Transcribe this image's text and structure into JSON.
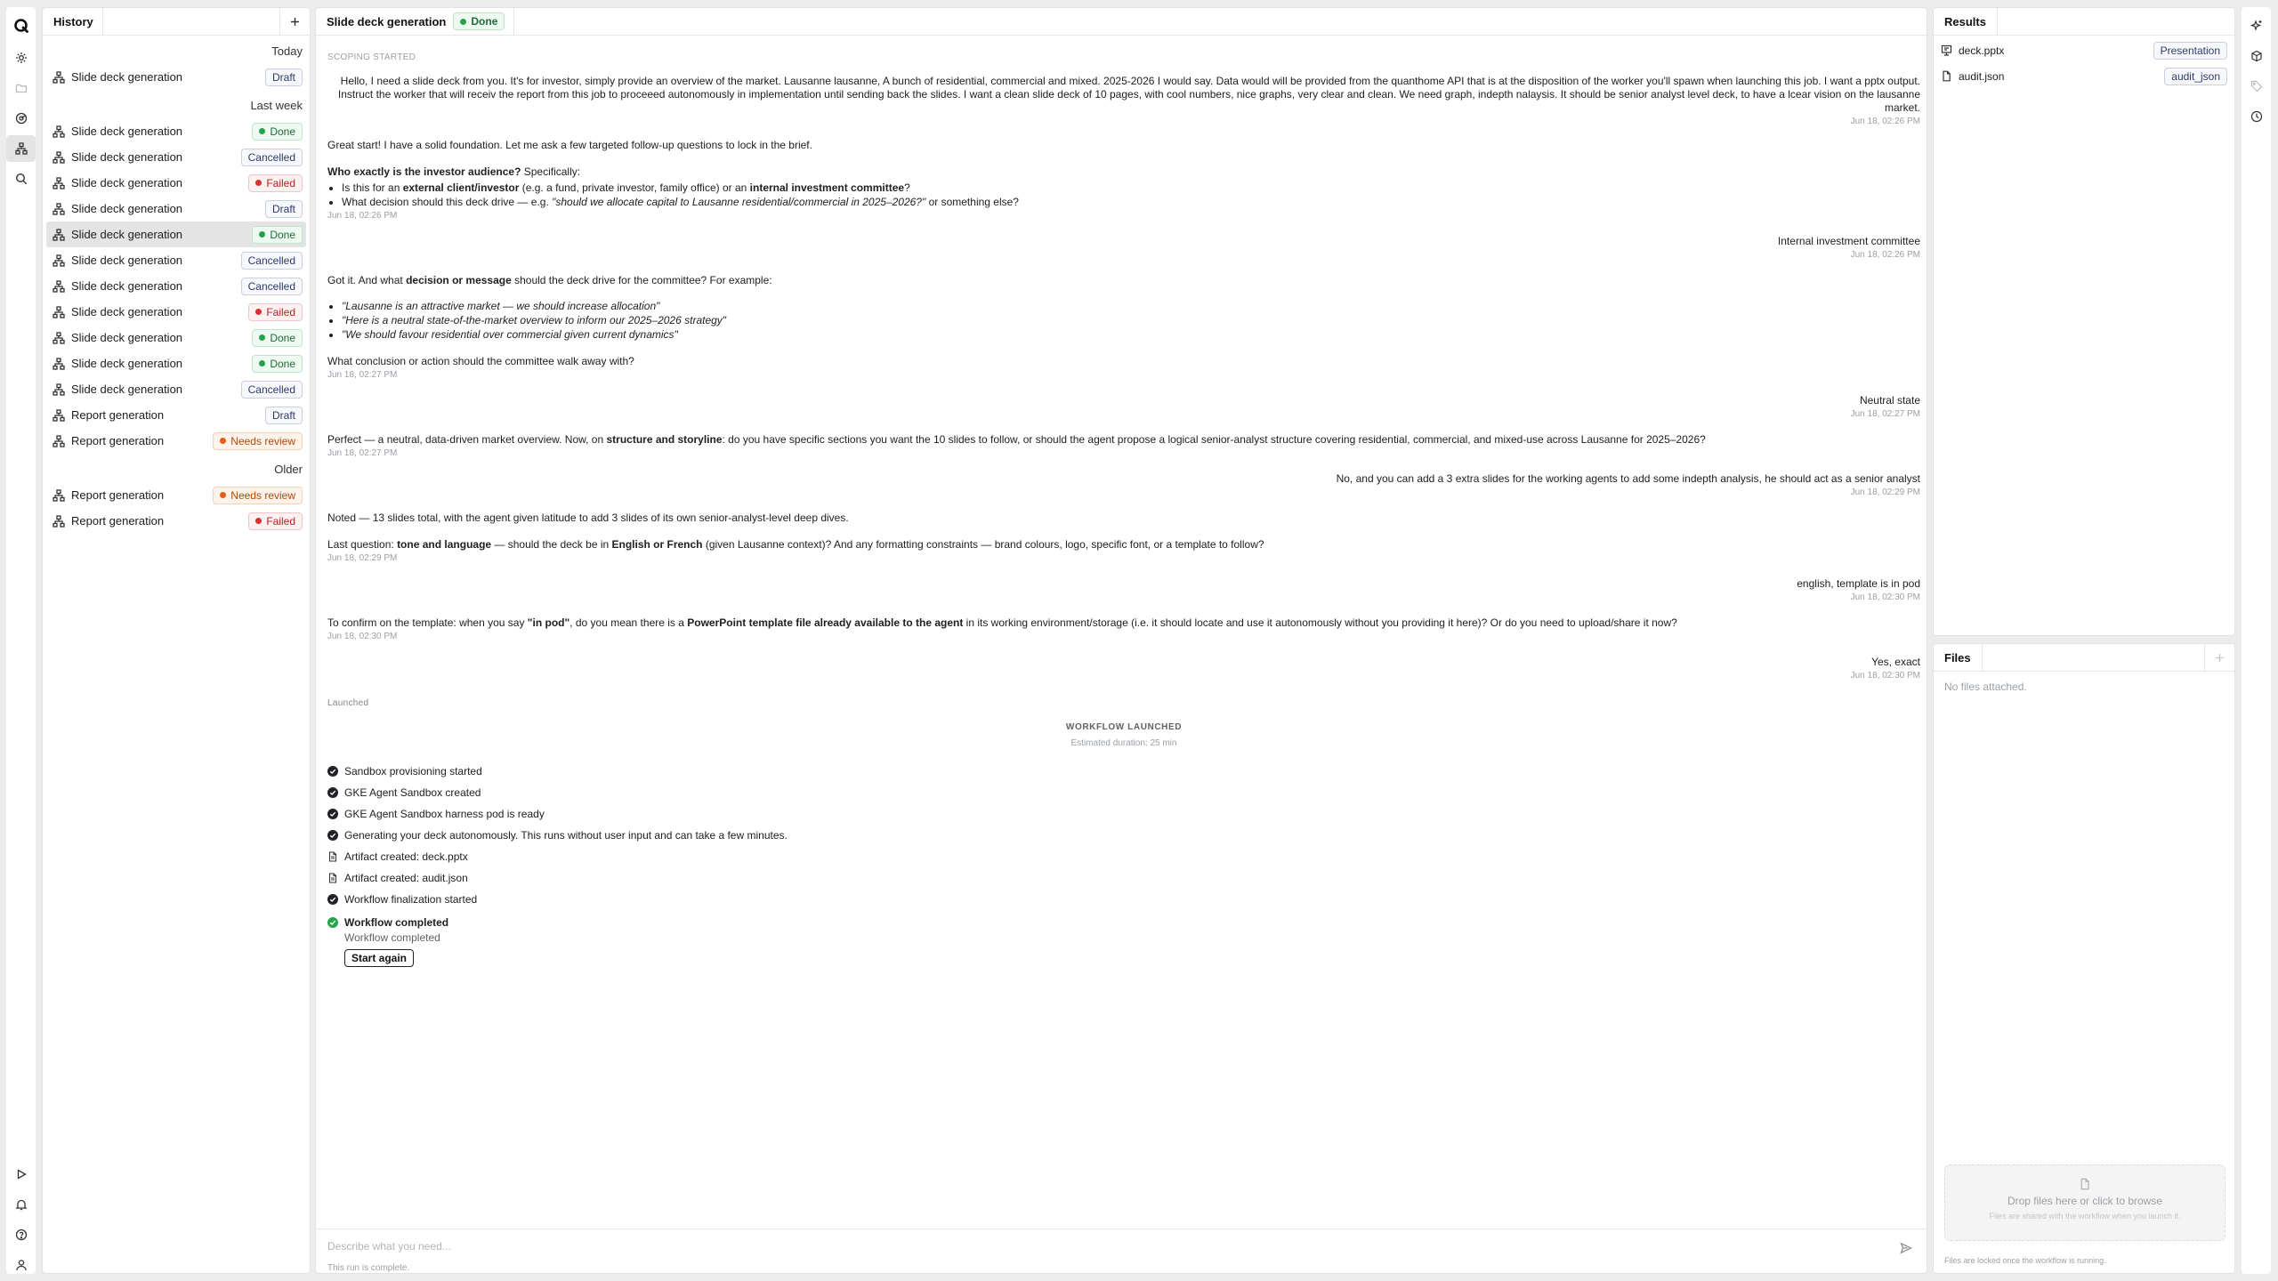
{
  "history": {
    "title": "History",
    "groups": [
      {
        "label": "Today",
        "items": [
          {
            "label": "Slide deck generation",
            "status": "Draft"
          }
        ]
      },
      {
        "label": "Last week",
        "items": [
          {
            "label": "Slide deck generation",
            "status": "Done"
          },
          {
            "label": "Slide deck generation",
            "status": "Cancelled"
          },
          {
            "label": "Slide deck generation",
            "status": "Failed"
          },
          {
            "label": "Slide deck generation",
            "status": "Draft"
          },
          {
            "label": "Slide deck generation",
            "status": "Done"
          },
          {
            "label": "Slide deck generation",
            "status": "Cancelled"
          },
          {
            "label": "Slide deck generation",
            "status": "Cancelled"
          },
          {
            "label": "Slide deck generation",
            "status": "Failed"
          },
          {
            "label": "Slide deck generation",
            "status": "Done"
          },
          {
            "label": "Slide deck generation",
            "status": "Done"
          },
          {
            "label": "Slide deck generation",
            "status": "Cancelled"
          },
          {
            "label": "Report generation",
            "status": "Draft"
          },
          {
            "label": "Report generation",
            "status": "Needs review"
          }
        ]
      },
      {
        "label": "Older",
        "items": [
          {
            "label": "Report generation",
            "status": "Needs review"
          },
          {
            "label": "Report generation",
            "status": "Failed"
          }
        ]
      }
    ]
  },
  "chat": {
    "tab_title": "Slide deck generation",
    "tab_status": "Done",
    "scoping_label": "SCOPING STARTED",
    "m1": {
      "text": "Hello, I need a slide deck from you. It's for investor, simply provide an overview of the market. Lausanne lausanne, A bunch of residential, commercial and mixed. 2025-2026 I would say. Data would will be provided from the quanthome API that is at the disposition of the worker you'll spawn when launching this job. I want a pptx output. Instruct the worker that will receiv the report from this job to proceeed autonomously in implementation until sending back the slides. I want a clean slide deck of 10 pages, with cool numbers, nice graphs, very clear and clean. We need graph, indepth nalaysis. It should be senior analyst level deck, to have a lcear vision on the lausanne market.",
      "ts": "Jun 18, 02:26 PM"
    },
    "m2": {
      "intro": "Great start! I have a solid foundation. Let me ask a few targeted follow-up questions to lock in the brief.",
      "q_bold": "Who exactly is the investor audience?",
      "q_rest": " Specifically:",
      "b1_a": "Is this for an ",
      "b1_b": "external client/investor",
      "b1_c": " (e.g. a fund, private investor, family office) or an ",
      "b1_d": "internal investment committee",
      "b1_e": "?",
      "b2_a": "What decision should this deck drive — e.g. ",
      "b2_b": "\"should we allocate capital to Lausanne residential/commercial in 2025–2026?\"",
      "b2_c": " or something else?",
      "ts": "Jun 18, 02:26 PM"
    },
    "m3": {
      "text": "Internal investment committee",
      "ts": "Jun 18, 02:26 PM"
    },
    "m4": {
      "a": "Got it. And what ",
      "b": "decision or message",
      "c": " should the deck drive for the committee? For example:",
      "e1": "\"Lausanne is an attractive market — we should increase allocation\"",
      "e2": "\"Here is a neutral state-of-the-market overview to inform our 2025–2026 strategy\"",
      "e3": "\"We should favour residential over commercial given current dynamics\"",
      "q": "What conclusion or action should the committee walk away with?",
      "ts": "Jun 18, 02:27 PM"
    },
    "m5": {
      "text": "Neutral state",
      "ts": "Jun 18, 02:27 PM"
    },
    "m6": {
      "a": "Perfect — a neutral, data-driven market overview. Now, on ",
      "b": "structure and storyline",
      "c": ": do you have specific sections you want the 10 slides to follow, or should the agent propose a logical senior-analyst structure covering residential, commercial, and mixed-use across Lausanne for 2025–2026?",
      "ts": "Jun 18, 02:27 PM"
    },
    "m7": {
      "text": "No, and you can add a 3 extra slides for the working agents to add some indepth analysis, he should act as a senior analyst",
      "ts": "Jun 18, 02:29 PM"
    },
    "m8": {
      "p1": "Noted — 13 slides total, with the agent given latitude to add 3 slides of its own senior-analyst-level deep dives.",
      "a": "Last question: ",
      "b": "tone and language",
      "c": " — should the deck be in ",
      "d": "English or French",
      "e": " (given Lausanne context)? And any formatting constraints — brand colours, logo, specific font, or a template to follow?",
      "ts": "Jun 18, 02:29 PM"
    },
    "m9": {
      "text": "english, template is in pod",
      "ts": "Jun 18, 02:30 PM"
    },
    "m10": {
      "a": "To confirm on the template: when you say ",
      "b": "\"in pod\"",
      "c": ", do you mean there is a ",
      "d": "PowerPoint template file already available to the agent",
      "e": " in its working environment/storage (i.e. it should locate and use it autonomously without you providing it here)? Or do you need to upload/share it now?",
      "ts": "Jun 18, 02:30 PM"
    },
    "m11": {
      "text": "Yes, exact",
      "ts": "Jun 18, 02:30 PM"
    },
    "launched_label": "Launched",
    "workflow": {
      "title": "WORKFLOW LAUNCHED",
      "duration": "Estimated duration: 25 min",
      "steps": [
        {
          "icon": "check-circle-icon",
          "text": "Sandbox provisioning started"
        },
        {
          "icon": "check-circle-icon",
          "text": "GKE Agent Sandbox created"
        },
        {
          "icon": "check-circle-icon",
          "text": "GKE Agent Sandbox harness pod is ready"
        },
        {
          "icon": "check-circle-icon",
          "text": "Generating your deck autonomously. This runs without user input and can take a few minutes."
        },
        {
          "icon": "file-icon",
          "text": "Artifact created: deck.pptx"
        },
        {
          "icon": "file-icon",
          "text": "Artifact created: audit.json"
        },
        {
          "icon": "check-circle-icon",
          "text": "Workflow finalization started"
        }
      ],
      "completed_title": "Workflow completed",
      "completed_sub": "Workflow completed",
      "start_again": "Start again"
    },
    "composer": {
      "placeholder": "Describe what you need...",
      "note": "This run is complete."
    }
  },
  "results": {
    "title": "Results",
    "items": [
      {
        "name": "deck.pptx",
        "tag": "Presentation",
        "icon": "presentation-icon"
      },
      {
        "name": "audit.json",
        "tag": "audit_json",
        "icon": "file-icon"
      }
    ]
  },
  "files": {
    "title": "Files",
    "empty": "No files attached.",
    "drop_main": "Drop files here or click to browse",
    "drop_sub": "Files are shared with the workflow when you launch it.",
    "note": "Files are locked once the workflow is running."
  },
  "colors": {
    "done": "#26a44a",
    "failed": "#d63030",
    "needs_review": "#e0601b",
    "neutral_badge": "#2d3a68"
  }
}
